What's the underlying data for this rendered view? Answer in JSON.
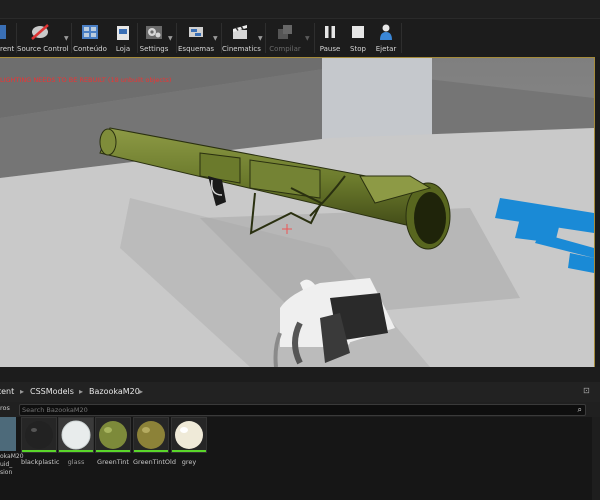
{
  "toolbar": {
    "buttons": [
      {
        "label": "rent",
        "icon": "content-icon"
      },
      {
        "label": "Source Control",
        "icon": "source-control-icon"
      },
      {
        "label": "Conteúdo",
        "icon": "content-icon"
      },
      {
        "label": "Loja",
        "icon": "store-icon"
      },
      {
        "label": "Settings",
        "icon": "settings-icon"
      },
      {
        "label": "Esquemas",
        "icon": "blueprints-icon"
      },
      {
        "label": "Cinematics",
        "icon": "cinematics-icon"
      },
      {
        "label": "Compilar",
        "icon": "build-icon",
        "disabled": true
      },
      {
        "label": "Pause",
        "icon": "pause-icon"
      },
      {
        "label": "Stop",
        "icon": "stop-icon"
      },
      {
        "label": "Ejetar",
        "icon": "eject-icon"
      }
    ]
  },
  "viewport": {
    "warning": "LIGHTING NEEDS TO BE REBUILT (18 unbuilt objects)",
    "colors": {
      "olive": "#6b7a2c",
      "floor": "#c8c8c8",
      "sky": "#8a8a8a",
      "blue_decal": "#1a8ad6"
    }
  },
  "content_browser": {
    "breadcrumbs": [
      "tent",
      "CSSModels",
      "BazookaM20"
    ],
    "separator": "▸",
    "filters_label": "ros",
    "search_placeholder": "Search BazookaM20",
    "left_fragment": [
      "okaM20",
      "uid_",
      "sion"
    ],
    "assets": [
      {
        "name": "blackplastic",
        "color": "#222222"
      },
      {
        "name": "glass",
        "color": "#e8ecec",
        "selected": true
      },
      {
        "name": "GreenTint",
        "color": "#7d8a3a"
      },
      {
        "name": "GreenTintOld",
        "color": "#8c8238"
      },
      {
        "name": "grey",
        "color": "#efead8"
      }
    ]
  }
}
